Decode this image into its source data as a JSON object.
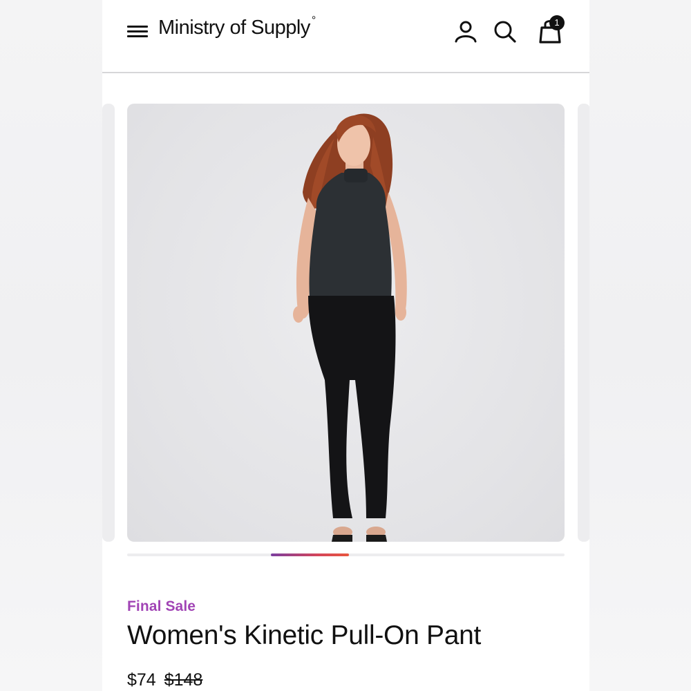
{
  "header": {
    "brand": "Ministry of Supply",
    "brand_mark": "°",
    "icons": [
      "menu-icon",
      "account-icon",
      "search-icon",
      "shopping-bag-icon"
    ],
    "cart_count": "1"
  },
  "carousel": {
    "image_alt": "Model wearing black sleeveless mock-neck top and black pull-on pants",
    "active_slide_fraction": 0.18
  },
  "product": {
    "badge": "Final Sale",
    "title": "Women's Kinetic Pull-On Pant",
    "price_current": "$74",
    "price_original": "$148"
  },
  "colors": {
    "badge": "#a144b5",
    "indicator_start": "#7b3fa0",
    "indicator_end": "#e8563f",
    "text": "#111111"
  }
}
